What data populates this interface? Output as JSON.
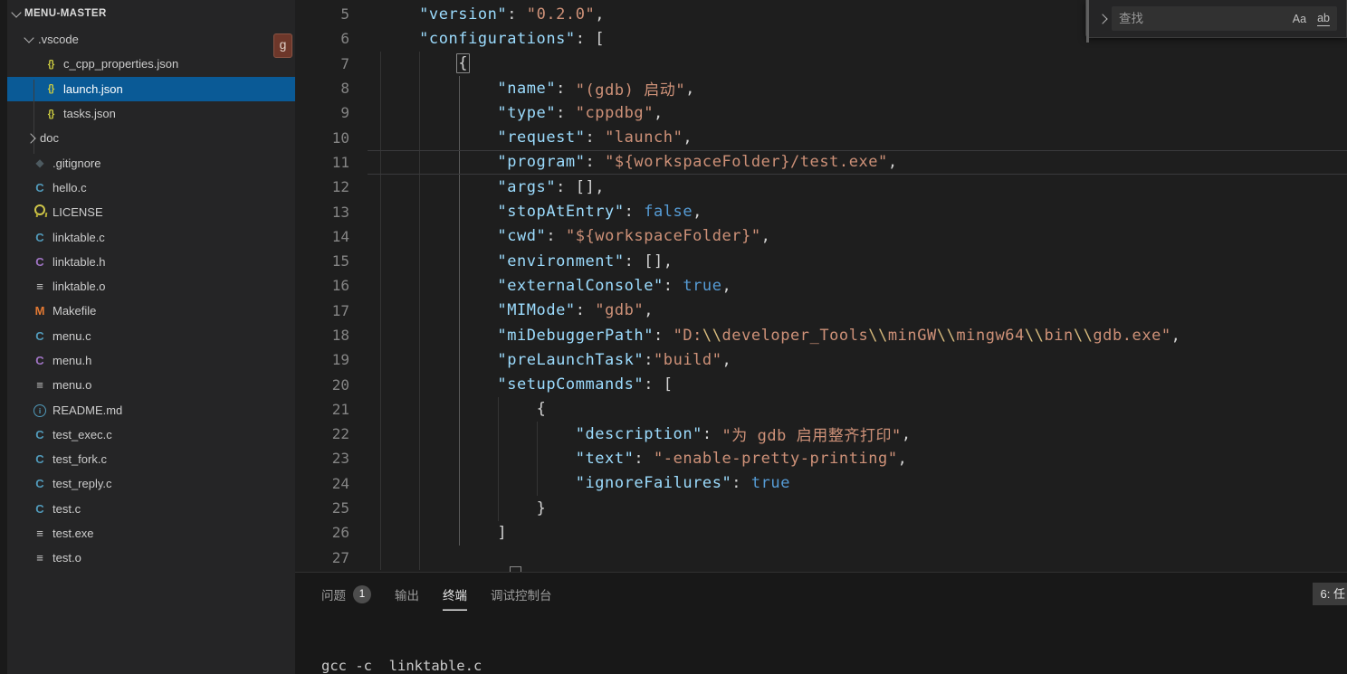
{
  "colors": {
    "editor_bg": "#1e1e1e",
    "sidebar_bg": "#252526",
    "panel_bg": "#181818",
    "selection_bg": "#0a5a96",
    "json_key": "#9cdcfe",
    "json_string": "#ce9178",
    "json_keyword": "#569cd6",
    "string_escape": "#d7ba7d",
    "punctuation": "#d4d4d4",
    "line_number": "#858585",
    "git_badge_bg": "#6d372a",
    "json_icon": "#cbcb41",
    "c_file_icon": "#519aba",
    "h_file_icon": "#a074c4",
    "makefile_icon": "#e37933"
  },
  "sidebar": {
    "title": "MENU-MASTER",
    "git_badge": "g",
    "items": [
      {
        "label": ".vscode",
        "icon": "chevron-down",
        "kind": "folder",
        "depth": 0
      },
      {
        "label": "c_cpp_properties.json",
        "icon": "json",
        "kind": "file",
        "depth": 1
      },
      {
        "label": "launch.json",
        "icon": "json",
        "kind": "file",
        "depth": 1,
        "selected": true
      },
      {
        "label": "tasks.json",
        "icon": "json",
        "kind": "file",
        "depth": 1
      },
      {
        "label": "doc",
        "icon": "chevron-right",
        "kind": "folder",
        "depth": 0
      },
      {
        "label": ".gitignore",
        "icon": "git",
        "kind": "file",
        "depth": 0
      },
      {
        "label": "hello.c",
        "icon": "c-source",
        "kind": "file",
        "depth": 0
      },
      {
        "label": "LICENSE",
        "icon": "license",
        "kind": "file",
        "depth": 0
      },
      {
        "label": "linktable.c",
        "icon": "c-source",
        "kind": "file",
        "depth": 0
      },
      {
        "label": "linktable.h",
        "icon": "c-header",
        "kind": "file",
        "depth": 0
      },
      {
        "label": "linktable.o",
        "icon": "object-file",
        "kind": "file",
        "depth": 0
      },
      {
        "label": "Makefile",
        "icon": "makefile",
        "kind": "file",
        "depth": 0
      },
      {
        "label": "menu.c",
        "icon": "c-source",
        "kind": "file",
        "depth": 0
      },
      {
        "label": "menu.h",
        "icon": "c-header",
        "kind": "file",
        "depth": 0
      },
      {
        "label": "menu.o",
        "icon": "object-file",
        "kind": "file",
        "depth": 0
      },
      {
        "label": "README.md",
        "icon": "readme-info",
        "kind": "file",
        "depth": 0
      },
      {
        "label": "test_exec.c",
        "icon": "c-source",
        "kind": "file",
        "depth": 0
      },
      {
        "label": "test_fork.c",
        "icon": "c-source",
        "kind": "file",
        "depth": 0
      },
      {
        "label": "test_reply.c",
        "icon": "c-source",
        "kind": "file",
        "depth": 0
      },
      {
        "label": "test.c",
        "icon": "c-source",
        "kind": "file",
        "depth": 0
      },
      {
        "label": "test.exe",
        "icon": "object-file",
        "kind": "file",
        "depth": 0
      },
      {
        "label": "test.o",
        "icon": "object-file",
        "kind": "file",
        "depth": 0
      }
    ]
  },
  "editor": {
    "filename": "launch.json",
    "current_line": 11,
    "lines": [
      {
        "n": 5,
        "tokens": [
          [
            "    ",
            "w"
          ],
          [
            "\"version\"",
            "k"
          ],
          [
            ": ",
            "p"
          ],
          [
            "\"0.2.0\"",
            "s"
          ],
          [
            ",",
            "p"
          ]
        ]
      },
      {
        "n": 6,
        "tokens": [
          [
            "    ",
            "w"
          ],
          [
            "\"configurations\"",
            "k"
          ],
          [
            ": ",
            "p"
          ],
          [
            "[",
            "p"
          ]
        ]
      },
      {
        "n": 7,
        "tokens": [
          [
            "        ",
            "w"
          ],
          [
            "{",
            "p x"
          ]
        ]
      },
      {
        "n": 8,
        "tokens": [
          [
            "            ",
            "w"
          ],
          [
            "\"name\"",
            "k"
          ],
          [
            ": ",
            "p"
          ],
          [
            "\"(gdb) 启动\"",
            "s"
          ],
          [
            ",",
            "p"
          ]
        ]
      },
      {
        "n": 9,
        "tokens": [
          [
            "            ",
            "w"
          ],
          [
            "\"type\"",
            "k"
          ],
          [
            ": ",
            "p"
          ],
          [
            "\"cppdbg\"",
            "s"
          ],
          [
            ",",
            "p"
          ]
        ]
      },
      {
        "n": 10,
        "tokens": [
          [
            "            ",
            "w"
          ],
          [
            "\"request\"",
            "k"
          ],
          [
            ": ",
            "p"
          ],
          [
            "\"launch\"",
            "s"
          ],
          [
            ",",
            "p"
          ]
        ]
      },
      {
        "n": 11,
        "current": true,
        "tokens": [
          [
            "            ",
            "w"
          ],
          [
            "\"program\"",
            "k"
          ],
          [
            ": ",
            "p"
          ],
          [
            "\"${workspaceFolder}/test.exe\"",
            "s"
          ],
          [
            ",",
            "p"
          ]
        ]
      },
      {
        "n": 12,
        "tokens": [
          [
            "            ",
            "w"
          ],
          [
            "\"args\"",
            "k"
          ],
          [
            ": ",
            "p"
          ],
          [
            "[],",
            "p"
          ]
        ]
      },
      {
        "n": 13,
        "tokens": [
          [
            "            ",
            "w"
          ],
          [
            "\"stopAtEntry\"",
            "k"
          ],
          [
            ": ",
            "p"
          ],
          [
            "false",
            "b"
          ],
          [
            ",",
            "p"
          ]
        ]
      },
      {
        "n": 14,
        "tokens": [
          [
            "            ",
            "w"
          ],
          [
            "\"cwd\"",
            "k"
          ],
          [
            ": ",
            "p"
          ],
          [
            "\"${workspaceFolder}\"",
            "s"
          ],
          [
            ",",
            "p"
          ]
        ]
      },
      {
        "n": 15,
        "tokens": [
          [
            "            ",
            "w"
          ],
          [
            "\"environment\"",
            "k"
          ],
          [
            ": ",
            "p"
          ],
          [
            "[],",
            "p"
          ]
        ]
      },
      {
        "n": 16,
        "tokens": [
          [
            "            ",
            "w"
          ],
          [
            "\"externalConsole\"",
            "k"
          ],
          [
            ": ",
            "p"
          ],
          [
            "true",
            "b"
          ],
          [
            ",",
            "p"
          ]
        ]
      },
      {
        "n": 17,
        "tokens": [
          [
            "            ",
            "w"
          ],
          [
            "\"MIMode\"",
            "k"
          ],
          [
            ": ",
            "p"
          ],
          [
            "\"gdb\"",
            "s"
          ],
          [
            ",",
            "p"
          ]
        ]
      },
      {
        "n": 18,
        "tokens": [
          [
            "            ",
            "w"
          ],
          [
            "\"miDebuggerPath\"",
            "k"
          ],
          [
            ": ",
            "p"
          ],
          [
            "\"D:",
            "s"
          ],
          [
            "\\\\",
            "e"
          ],
          [
            "developer_Tools",
            "s"
          ],
          [
            "\\\\",
            "e"
          ],
          [
            "minGW",
            "s"
          ],
          [
            "\\\\",
            "e"
          ],
          [
            "mingw64",
            "s"
          ],
          [
            "\\\\",
            "e"
          ],
          [
            "bin",
            "s"
          ],
          [
            "\\\\",
            "e"
          ],
          [
            "gdb.exe\"",
            "s"
          ],
          [
            ",",
            "p"
          ]
        ]
      },
      {
        "n": 19,
        "tokens": [
          [
            "            ",
            "w"
          ],
          [
            "\"preLaunchTask\"",
            "k"
          ],
          [
            ":",
            "p"
          ],
          [
            "\"build\"",
            "s"
          ],
          [
            ",",
            "p"
          ]
        ]
      },
      {
        "n": 20,
        "tokens": [
          [
            "            ",
            "w"
          ],
          [
            "\"setupCommands\"",
            "k"
          ],
          [
            ": ",
            "p"
          ],
          [
            "[",
            "p"
          ]
        ]
      },
      {
        "n": 21,
        "tokens": [
          [
            "                ",
            "w"
          ],
          [
            "{",
            "p"
          ]
        ]
      },
      {
        "n": 22,
        "tokens": [
          [
            "                    ",
            "w"
          ],
          [
            "\"description\"",
            "k"
          ],
          [
            ": ",
            "p"
          ],
          [
            "\"为 gdb 启用整齐打印\"",
            "s"
          ],
          [
            ",",
            "p"
          ]
        ]
      },
      {
        "n": 23,
        "tokens": [
          [
            "                    ",
            "w"
          ],
          [
            "\"text\"",
            "k"
          ],
          [
            ": ",
            "p"
          ],
          [
            "\"-enable-pretty-printing\"",
            "s"
          ],
          [
            ",",
            "p"
          ]
        ]
      },
      {
        "n": 24,
        "tokens": [
          [
            "                    ",
            "w"
          ],
          [
            "\"ignoreFailures\"",
            "k"
          ],
          [
            ": ",
            "p"
          ],
          [
            "true",
            "b"
          ]
        ]
      },
      {
        "n": 25,
        "tokens": [
          [
            "                ",
            "w"
          ],
          [
            "}",
            "p"
          ]
        ]
      },
      {
        "n": 26,
        "tokens": [
          [
            "            ",
            "w"
          ],
          [
            "]",
            "p"
          ]
        ]
      },
      {
        "n": 27,
        "tokens": []
      }
    ]
  },
  "find": {
    "placeholder": "查找",
    "match_case_icon": "Aa",
    "whole_word_icon": "ab",
    "toggle_icon": "chevron-right"
  },
  "panel": {
    "tabs": [
      {
        "label": "问题",
        "badge": "1"
      },
      {
        "label": "输出"
      },
      {
        "label": "终端",
        "active": true
      },
      {
        "label": "调试控制台"
      }
    ],
    "task_select": "6: 任",
    "terminal_line": "gcc -c  linktable.c"
  }
}
